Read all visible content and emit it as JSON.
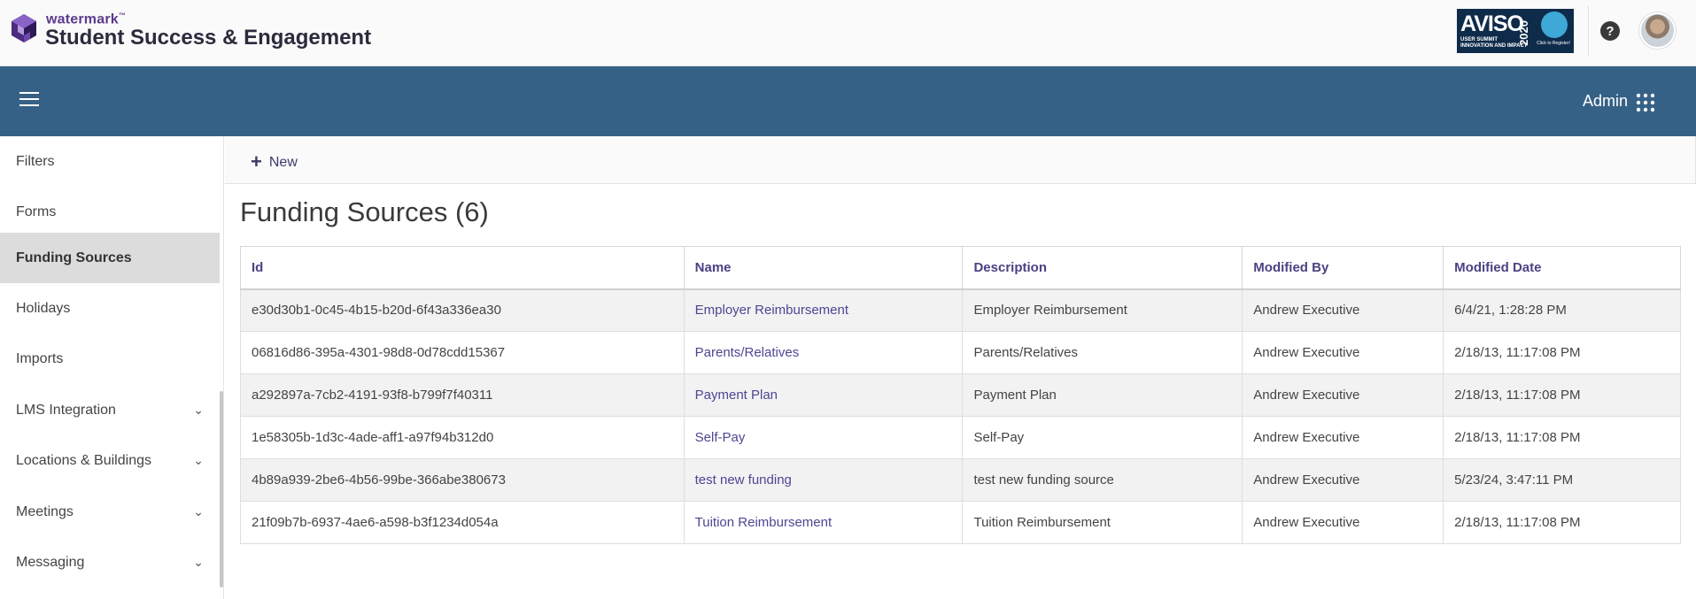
{
  "brand": {
    "small": "watermark",
    "trademark": "™",
    "name": "Student Success & Engagement"
  },
  "promo": {
    "big": "AVISO",
    "year": "2020",
    "sub_line1": "USER SUMMIT",
    "sub_line2": "INNOVATION AND IMPACT",
    "tiny": "Click to Register!"
  },
  "navbar": {
    "admin_label": "Admin"
  },
  "sidebar": {
    "items": [
      {
        "label": "Filters"
      },
      {
        "label": "Forms"
      },
      {
        "label": "Funding Sources"
      },
      {
        "label": "Holidays"
      },
      {
        "label": "Imports"
      },
      {
        "label": "LMS Integration"
      },
      {
        "label": "Locations & Buildings"
      },
      {
        "label": "Meetings"
      },
      {
        "label": "Messaging"
      }
    ]
  },
  "toolbar": {
    "new_label": "New"
  },
  "page": {
    "title": "Funding Sources (6)"
  },
  "table": {
    "headers": [
      "Id",
      "Name",
      "Description",
      "Modified By",
      "Modified Date"
    ],
    "rows": [
      [
        "e30d30b1-0c45-4b15-b20d-6f43a336ea30",
        "Employer Reimbursement",
        "Employer Reimbursement",
        "Andrew Executive",
        "6/4/21, 1:28:28 PM"
      ],
      [
        "06816d86-395a-4301-98d8-0d78cdd15367",
        "Parents/Relatives",
        "Parents/Relatives",
        "Andrew Executive",
        "2/18/13, 11:17:08 PM"
      ],
      [
        "a292897a-7cb2-4191-93f8-b799f7f40311",
        "Payment Plan",
        "Payment Plan",
        "Andrew Executive",
        "2/18/13, 11:17:08 PM"
      ],
      [
        "1e58305b-1d3c-4ade-aff1-a97f94b312d0",
        "Self-Pay",
        "Self-Pay",
        "Andrew Executive",
        "2/18/13, 11:17:08 PM"
      ],
      [
        "4b89a939-2be6-4b56-99be-366abe380673",
        "test new funding",
        "test new funding source",
        "Andrew Executive",
        "5/23/24, 3:47:11 PM"
      ],
      [
        "21f09b7b-6937-4ae6-a598-b3f1234d054a",
        "Tuition Reimbursement",
        "Tuition Reimbursement",
        "Andrew Executive",
        "2/18/13, 11:17:08 PM"
      ]
    ]
  },
  "colors": {
    "navbar": "#366186",
    "link": "#4c4693",
    "brand_purple": "#5b3a8e",
    "active_item": "#dcdcdc"
  },
  "icons": {
    "menu": "hamburger-icon",
    "apps": "grid-dots-icon",
    "help": "question-circle-icon",
    "add": "plus-icon",
    "expand": "chevron-down-icon"
  }
}
